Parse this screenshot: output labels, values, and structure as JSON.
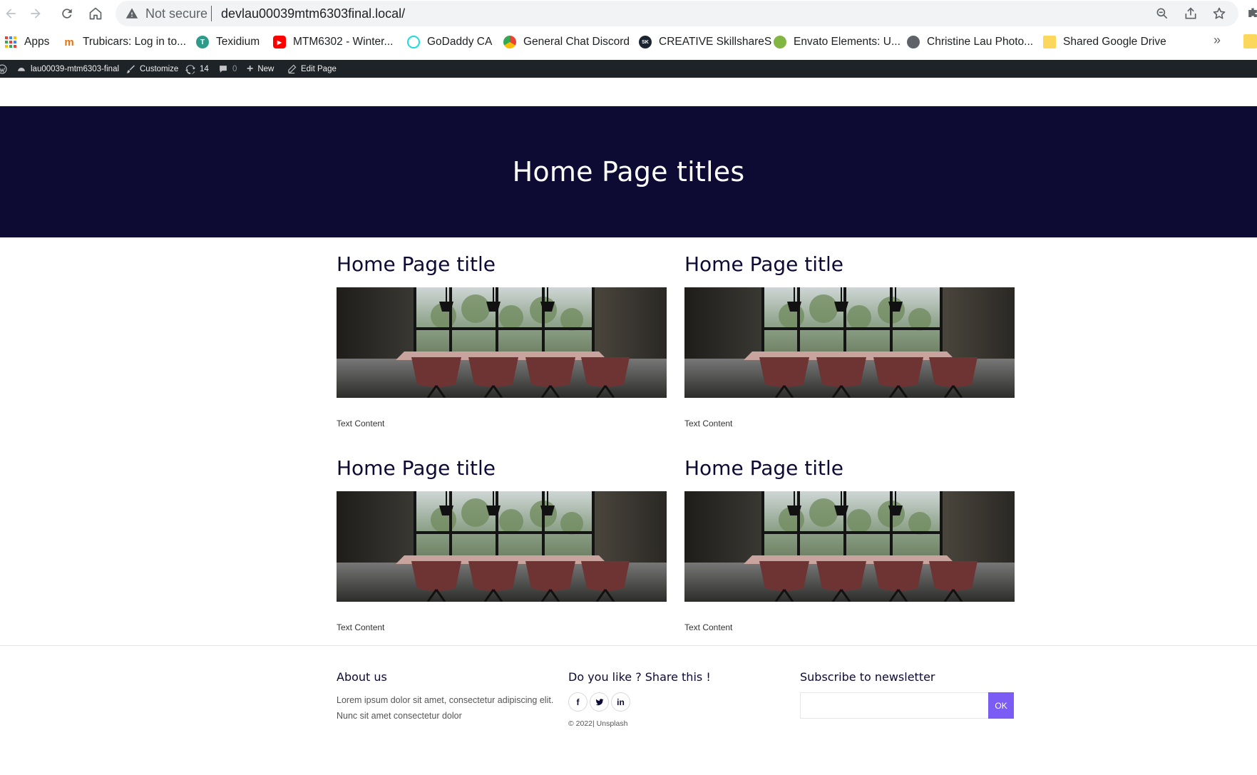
{
  "browser": {
    "security_label": "Not secure",
    "url": "devlau00039mtm6303final.local/",
    "bookmarks": [
      {
        "label": "Apps",
        "icon": "apps-grid-icon"
      },
      {
        "label": "Trubicars: Log in to...",
        "icon": "trubicars-icon"
      },
      {
        "label": "Texidium",
        "icon": "texidium-icon"
      },
      {
        "label": "MTM6302 - Winter...",
        "icon": "youtube-icon"
      },
      {
        "label": "GoDaddy CA",
        "icon": "godaddy-icon"
      },
      {
        "label": "General Chat Discord",
        "icon": "chrome-icon"
      },
      {
        "label": "CREATIVE SkillshareS",
        "icon": "skillshare-icon"
      },
      {
        "label": "Envato Elements: U...",
        "icon": "envato-icon"
      },
      {
        "label": "Christine Lau Photo...",
        "icon": "globe-icon"
      },
      {
        "label": "Shared Google Drive",
        "icon": "folder-icon"
      }
    ],
    "more_label": "»"
  },
  "adminbar": {
    "site_name": "lau00039-mtm6303-final",
    "customize": "Customize",
    "updates_count": "14",
    "comments_count": "0",
    "new_label": "New",
    "edit_label": "Edit Page"
  },
  "hero": {
    "title": "Home Page titles"
  },
  "cards": [
    {
      "title": "Home Page title",
      "text": "Text Content"
    },
    {
      "title": "Home Page title",
      "text": "Text Content"
    },
    {
      "title": "Home Page title",
      "text": "Text Content"
    },
    {
      "title": "Home Page title",
      "text": "Text Content"
    }
  ],
  "footer": {
    "about": {
      "title": "About us",
      "body": "Lorem ipsum dolor sit amet, consectetur adipiscing elit. Nunc sit amet consectetur dolor"
    },
    "share": {
      "title": "Do you like ? Share this !",
      "icons": [
        "f",
        "t",
        "in"
      ],
      "copyright": "© 2022| Unsplash"
    },
    "newsletter": {
      "title": "Subscribe to newsletter",
      "placeholder": "",
      "button": "OK"
    }
  },
  "colors": {
    "hero_bg": "#0d0a33",
    "accent": "#7b5cf5",
    "adminbar_bg": "#1d2327"
  }
}
